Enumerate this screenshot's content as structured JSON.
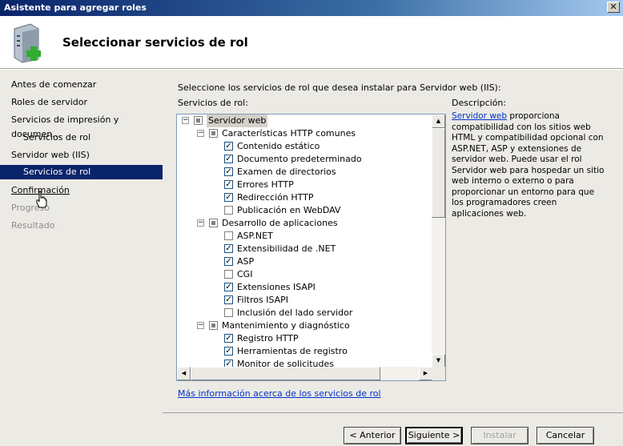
{
  "window": {
    "title": "Asistente para agregar roles",
    "close_label": "✕"
  },
  "header": {
    "title": "Seleccionar servicios de rol",
    "icon": "server-add-icon"
  },
  "nav": {
    "items": [
      {
        "label": "Antes de comenzar",
        "state": "normal"
      },
      {
        "label": "Roles de servidor",
        "state": "normal"
      },
      {
        "label": "Servicios de impresión y documen...",
        "state": "normal"
      },
      {
        "label": "Servicios de rol",
        "state": "sub"
      },
      {
        "label": "Servidor web (IIS)",
        "state": "normal"
      },
      {
        "label": "Servicios de rol",
        "state": "active"
      },
      {
        "label": "Confirmación",
        "state": "link"
      },
      {
        "label": "Progreso",
        "state": "disabled"
      },
      {
        "label": "Resultado",
        "state": "disabled"
      }
    ]
  },
  "main": {
    "intro": "Seleccione los servicios de rol que desea instalar para Servidor web (IIS):",
    "roles_label": "Servicios de rol:",
    "desc_label": "Descripción:",
    "desc_link": "Servidor web",
    "desc_text": " proporciona compatibilidad con los sitios web HTML y compatibilidad opcional con ASP.NET, ASP y extensiones de servidor web. Puede usar el rol Servidor web para hospedar un sitio web interno o externo o para proporcionar un entorno para que los programadores creen aplicaciones web.",
    "more_link": "Más información acerca de los servicios de rol"
  },
  "tree": [
    {
      "label": "Servidor web",
      "level": 0,
      "state": "partial",
      "expander": "−",
      "selected": true
    },
    {
      "label": "Características HTTP comunes",
      "level": 1,
      "state": "partial",
      "expander": "−"
    },
    {
      "label": "Contenido estático",
      "level": 2,
      "state": "checked"
    },
    {
      "label": "Documento predeterminado",
      "level": 2,
      "state": "checked"
    },
    {
      "label": "Examen de directorios",
      "level": 2,
      "state": "checked"
    },
    {
      "label": "Errores HTTP",
      "level": 2,
      "state": "checked"
    },
    {
      "label": "Redirección HTTP",
      "level": 2,
      "state": "checked"
    },
    {
      "label": "Publicación en WebDAV",
      "level": 2,
      "state": "unchecked"
    },
    {
      "label": "Desarrollo de aplicaciones",
      "level": 1,
      "state": "partial",
      "expander": "−"
    },
    {
      "label": "ASP.NET",
      "level": 2,
      "state": "unchecked"
    },
    {
      "label": "Extensibilidad de .NET",
      "level": 2,
      "state": "checked"
    },
    {
      "label": "ASP",
      "level": 2,
      "state": "checked"
    },
    {
      "label": "CGI",
      "level": 2,
      "state": "unchecked"
    },
    {
      "label": "Extensiones ISAPI",
      "level": 2,
      "state": "checked"
    },
    {
      "label": "Filtros ISAPI",
      "level": 2,
      "state": "checked"
    },
    {
      "label": "Inclusión del lado servidor",
      "level": 2,
      "state": "unchecked"
    },
    {
      "label": "Mantenimiento y diagnóstico",
      "level": 1,
      "state": "partial",
      "expander": "−"
    },
    {
      "label": "Registro HTTP",
      "level": 2,
      "state": "checked"
    },
    {
      "label": "Herramientas de registro",
      "level": 2,
      "state": "checked"
    },
    {
      "label": "Monitor de solicitudes",
      "level": 2,
      "state": "checked"
    }
  ],
  "buttons": {
    "back": "< Anterior",
    "next": "Siguiente >",
    "install": "Instalar",
    "cancel": "Cancelar"
  },
  "colors": {
    "nav_active": "#0a246a",
    "link": "#0033cc",
    "panel": "#eceae4"
  }
}
